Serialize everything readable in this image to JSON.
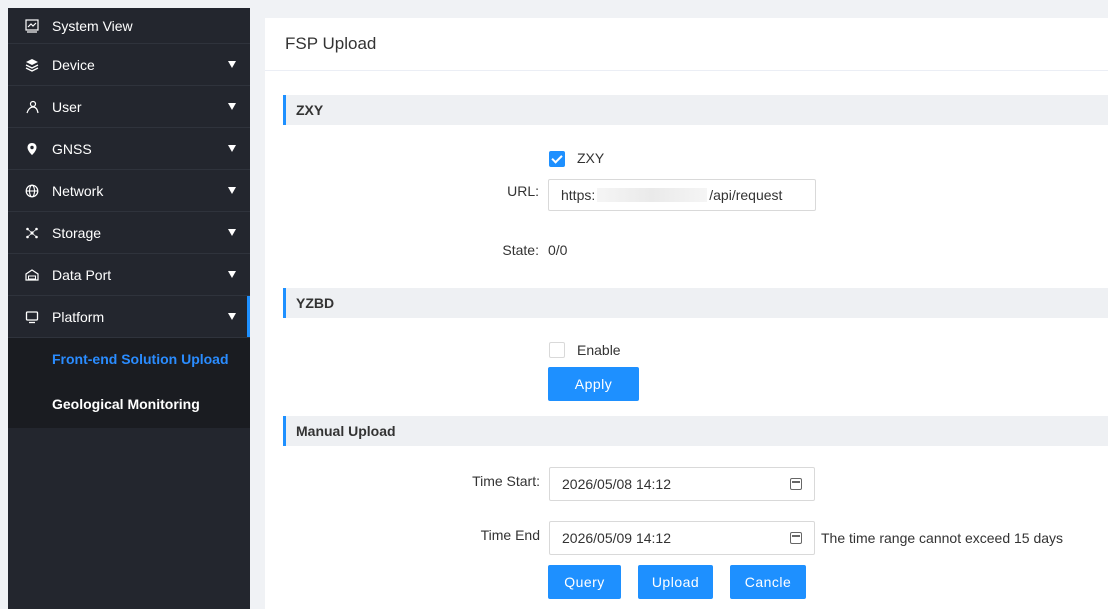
{
  "sidebar": {
    "items": [
      {
        "label": "System View",
        "icon": "chart-icon"
      },
      {
        "label": "Device",
        "icon": "layers-icon"
      },
      {
        "label": "User",
        "icon": "user-icon"
      },
      {
        "label": "GNSS",
        "icon": "location-pin-icon"
      },
      {
        "label": "Network",
        "icon": "globe-icon"
      },
      {
        "label": "Storage",
        "icon": "storage-icon"
      },
      {
        "label": "Data Port",
        "icon": "data-port-icon"
      },
      {
        "label": "Platform",
        "icon": "monitor-icon"
      }
    ],
    "subitems": [
      {
        "label": "Front-end Solution Upload",
        "active": true
      },
      {
        "label": "Geological Monitoring",
        "active": false
      }
    ]
  },
  "page": {
    "title": "FSP Upload"
  },
  "zxy": {
    "section_title": "ZXY",
    "checkbox_label": "ZXY",
    "url_label": "URL:",
    "url_prefix": "https:",
    "url_suffix": "/api/request",
    "state_label": "State:",
    "state_value": "0/0"
  },
  "yzbd": {
    "section_title": "YZBD",
    "checkbox_label": "Enable",
    "apply_label": "Apply"
  },
  "manual": {
    "section_title": "Manual Upload",
    "time_start_label": "Time Start:",
    "time_start_value": "2026/05/08 14:12",
    "time_end_label": "Time End",
    "time_end_value": "2026/05/09 14:12",
    "hint": "The time range cannot exceed 15 days",
    "query_label": "Query",
    "upload_label": "Upload",
    "cancel_label": "Cancle"
  },
  "colors": {
    "accent": "#1e90ff",
    "sidebar_bg": "#23262e",
    "active_sub": "#2a8cff"
  }
}
